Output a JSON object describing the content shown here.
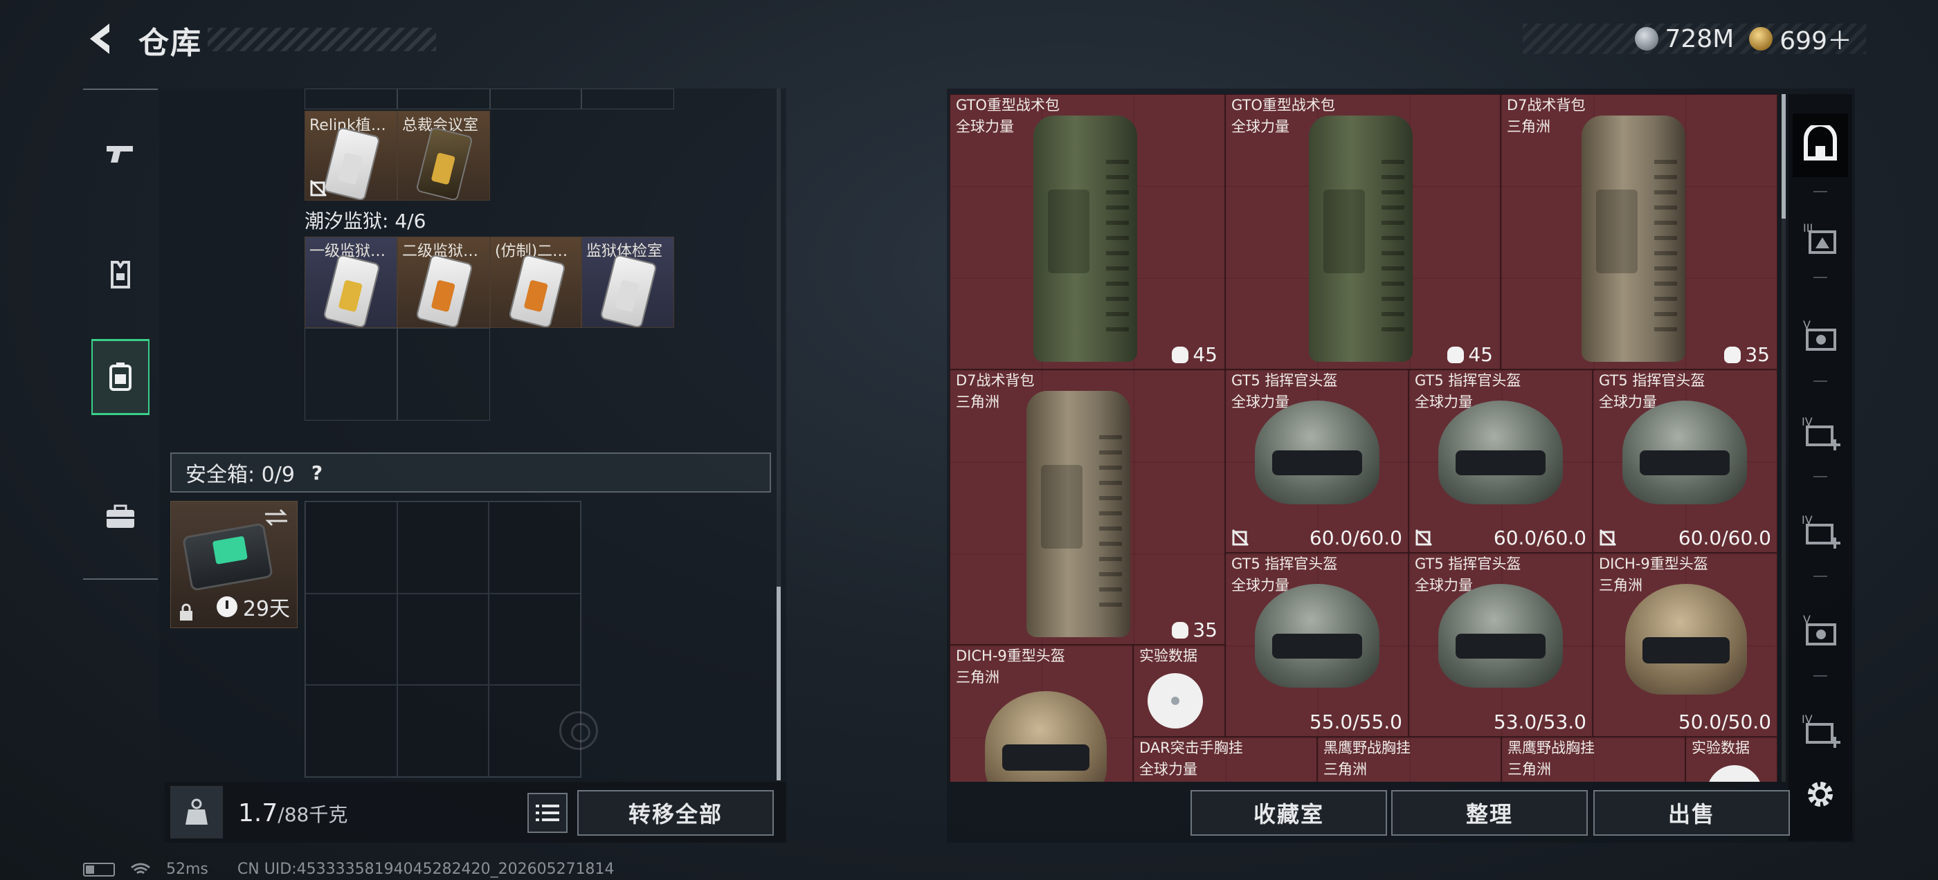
{
  "header": {
    "title": "仓库"
  },
  "currency": {
    "silver": "728M",
    "gold": "699＋"
  },
  "sidebar": {
    "items": [
      "weapons-tab",
      "armor-tab",
      "backpack-tab",
      "case-tab"
    ],
    "active": "backpack-tab"
  },
  "storage": {
    "top_items": [
      {
        "name": "Relink植…",
        "color": "gold"
      },
      {
        "name": "总裁会议室",
        "color": "gold"
      }
    ],
    "prison_label": "潮汐监狱: 4/6",
    "prison_items": [
      {
        "name": "一级监狱…",
        "color": "blue"
      },
      {
        "name": "二级监狱…",
        "color": "gold"
      },
      {
        "name": "(仿制)二…",
        "color": "gold"
      },
      {
        "name": "监狱体检室",
        "color": "blue"
      }
    ],
    "safe_label": "安全箱: 0/9",
    "help": "?",
    "safe_days": "29天",
    "weight_value": "1.7",
    "weight_unit": "/88千克",
    "transfer_all": "转移全部"
  },
  "status": {
    "ping": "52ms",
    "uid": "CN UID:45333358194045282420_202605271814"
  },
  "market": {
    "items": [
      {
        "name": "GTO重型战术包",
        "sub": "全球力量",
        "cap": "45"
      },
      {
        "name": "GTO重型战术包",
        "sub": "全球力量",
        "cap": "45"
      },
      {
        "name": "D7战术背包",
        "sub": "三角洲",
        "cap": "35"
      },
      {
        "name": "D7战术背包",
        "sub": "三角洲",
        "cap": "35"
      },
      {
        "name": "GT5 指挥官头盔",
        "sub": "全球力量",
        "dur": "60.0/60.0"
      },
      {
        "name": "GT5 指挥官头盔",
        "sub": "全球力量",
        "dur": "60.0/60.0"
      },
      {
        "name": "GT5 指挥官头盔",
        "sub": "全球力量",
        "dur": "60.0/60.0"
      },
      {
        "name": "GT5 指挥官头盔",
        "sub": "全球力量",
        "dur": "55.0/55.0"
      },
      {
        "name": "GT5 指挥官头盔",
        "sub": "全球力量",
        "dur": "53.0/53.0"
      },
      {
        "name": "DICH-9重型头盔",
        "sub": "三角洲",
        "dur": "50.0/50.0"
      },
      {
        "name": "DICH-9重型头盔",
        "sub": "三角洲"
      },
      {
        "name": "实验数据",
        "sub": ""
      },
      {
        "name": "DAR突击手胸挂",
        "sub": "全球力量"
      },
      {
        "name": "黑鹰野战胸挂",
        "sub": "三角洲"
      },
      {
        "name": "黑鹰野战胸挂",
        "sub": "三角洲"
      },
      {
        "name": "实验数据",
        "sub": ""
      }
    ],
    "buttons": {
      "collection": "收藏室",
      "organize": "整理",
      "sell": "出售"
    }
  },
  "filters": [
    "all-icon",
    "tier-iii-armor-icon",
    "tier-v-armor-icon",
    "tier-iv-medkit-icon",
    "tier-iv-medkit-icon",
    "tier-v-armor-icon",
    "tier-iv-medkit-icon"
  ]
}
